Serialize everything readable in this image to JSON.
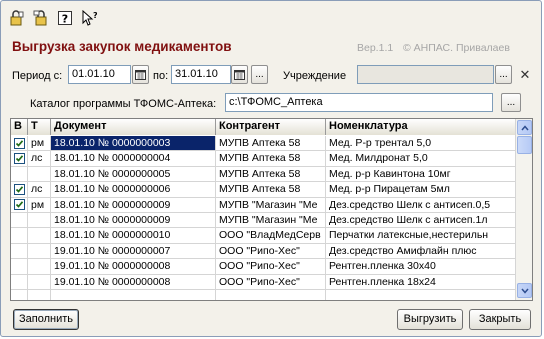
{
  "toolbar": {
    "items": [
      {
        "name": "lock-open-icon"
      },
      {
        "name": "lock-edit-icon"
      },
      {
        "name": "help-icon"
      },
      {
        "name": "whats-this-icon"
      }
    ]
  },
  "header": {
    "title": "Выгрузка закупок медикаментов",
    "version": "Вер.1.1",
    "copyright": "© АНПАС. Привалаев"
  },
  "filters": {
    "period_label": "Период с:",
    "date_from": "01.01.10",
    "to_label": "по:",
    "date_to": "31.01.10",
    "ellipsis": "...",
    "institution_label": "Учреждение",
    "institution_value": "",
    "clear_icon": "close-icon",
    "catalog_label": "Каталог программы ТФОМС-Аптека:",
    "catalog_path": "c:\\ТФОМС_Аптека"
  },
  "table": {
    "columns": [
      "В",
      "Т",
      "Документ",
      "Контрагент",
      "Номенклатура"
    ],
    "rows": [
      {
        "checked": true,
        "t": "рм",
        "doc": "18.01.10 № 0000000003",
        "ctr": "МУПВ Аптека  58",
        "nom": "Мед. Р-р трентал 5,0",
        "selected": true
      },
      {
        "checked": true,
        "t": "лс",
        "doc": "18.01.10 № 0000000004",
        "ctr": "МУПВ Аптека  58",
        "nom": "Мед. Милдронат 5,0",
        "selected": false
      },
      {
        "checked": false,
        "t": "",
        "doc": "18.01.10 № 0000000005",
        "ctr": "МУПВ Аптека  58",
        "nom": "Мед. р-р Кавинтона 10мг",
        "selected": false
      },
      {
        "checked": true,
        "t": "лс",
        "doc": "18.01.10 № 0000000006",
        "ctr": "МУПВ Аптека  58",
        "nom": "Мед. р-р Пирацетам 5мл",
        "selected": false
      },
      {
        "checked": true,
        "t": "рм",
        "doc": "18.01.10 № 0000000009",
        "ctr": "МУПВ \"Магазин \"Ме",
        "nom": "Дез.средство Шелк с антисеп.0,5",
        "selected": false
      },
      {
        "checked": false,
        "t": "",
        "doc": "18.01.10 № 0000000009",
        "ctr": "МУПВ \"Магазин \"Ме",
        "nom": "Дез.средство Шелк с антисеп.1л",
        "selected": false
      },
      {
        "checked": false,
        "t": "",
        "doc": "18.01.10 № 0000000010",
        "ctr": "ООО \"ВладМедСерв",
        "nom": "Перчатки латексные,нестерильн",
        "selected": false
      },
      {
        "checked": false,
        "t": "",
        "doc": "19.01.10 № 0000000007",
        "ctr": "ООО \"Рипо-Хес\"",
        "nom": "Дез.средство Амифлайн плюс",
        "selected": false
      },
      {
        "checked": false,
        "t": "",
        "doc": "19.01.10 № 0000000008",
        "ctr": "ООО \"Рипо-Хес\"",
        "nom": "Рентген.пленка 30х40",
        "selected": false
      },
      {
        "checked": false,
        "t": "",
        "doc": "19.01.10 № 0000000008",
        "ctr": "ООО \"Рипо-Хес\"",
        "nom": "Рентген.пленка 18х24",
        "selected": false
      },
      {
        "checked": false,
        "t": "",
        "doc": "",
        "ctr": "",
        "nom": "",
        "selected": false
      }
    ]
  },
  "buttons": {
    "fill": "Заполнить",
    "export": "Выгрузить",
    "close": "Закрыть"
  },
  "colors": {
    "title": "#801010",
    "selection": "#0a246a",
    "window_bg": "#f3f1ea"
  }
}
